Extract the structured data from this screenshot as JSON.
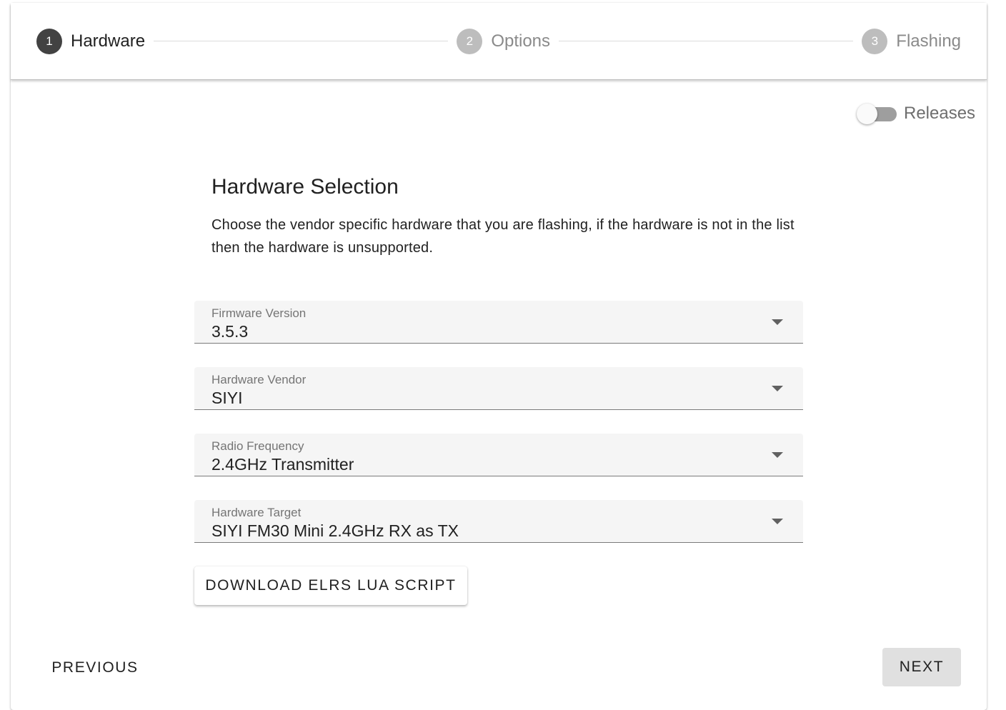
{
  "stepper": {
    "steps": [
      {
        "number": "1",
        "label": "Hardware",
        "active": true
      },
      {
        "number": "2",
        "label": "Options",
        "active": false
      },
      {
        "number": "3",
        "label": "Flashing",
        "active": false
      }
    ]
  },
  "releases_toggle": {
    "label": "Releases",
    "checked": false
  },
  "section": {
    "heading": "Hardware Selection",
    "description": "Choose the vendor specific hardware that you are flashing, if the hardware is not in the list then the hardware is unsupported."
  },
  "fields": [
    {
      "label": "Firmware Version",
      "value": "3.5.3",
      "icon": "caret-down-icon"
    },
    {
      "label": "Hardware Vendor",
      "value": "SIYI",
      "icon": "caret-down-icon"
    },
    {
      "label": "Radio Frequency",
      "value": "2.4GHz Transmitter",
      "icon": "caret-down-icon"
    },
    {
      "label": "Hardware Target",
      "value": "SIYI FM30 Mini 2.4GHz RX as TX",
      "icon": "caret-down-icon"
    }
  ],
  "buttons": {
    "download_lua": "DOWNLOAD ELRS LUA SCRIPT",
    "previous": "PREVIOUS",
    "next": "NEXT"
  }
}
